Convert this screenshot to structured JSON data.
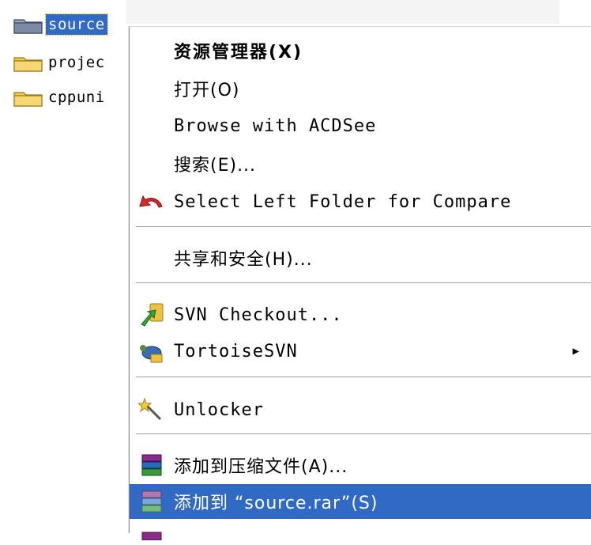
{
  "explorer": {
    "folders": [
      {
        "name": "source",
        "selected": true
      },
      {
        "name": "projec",
        "selected": false
      },
      {
        "name": "cppuni",
        "selected": false
      }
    ]
  },
  "context_menu": {
    "items": [
      {
        "label": "资源管理器(X)",
        "bold": true
      },
      {
        "label": "打开(O)"
      },
      {
        "label": "Browse with ACDSee"
      },
      {
        "label": "搜索(E)..."
      },
      {
        "label": "Select Left Folder for Compare",
        "icon": "undo-arrow-icon"
      },
      {
        "label": "共享和安全(H)..."
      },
      {
        "label": "SVN Checkout...",
        "icon": "svn-checkout-icon"
      },
      {
        "label": "TortoiseSVN",
        "icon": "tortoisesvn-icon",
        "submenu_arrow": "▶"
      },
      {
        "label": "Unlocker",
        "icon": "unlocker-wand-icon"
      },
      {
        "label": "添加到压缩文件(A)...",
        "icon": "winrar-icon"
      },
      {
        "label": "添加到 “source.rar”(S)",
        "icon": "winrar-icon",
        "selected": true
      }
    ]
  },
  "colors": {
    "selection": "#316ac5",
    "folder_yellow": "#f7d774",
    "separator": "#a0a0a0"
  }
}
